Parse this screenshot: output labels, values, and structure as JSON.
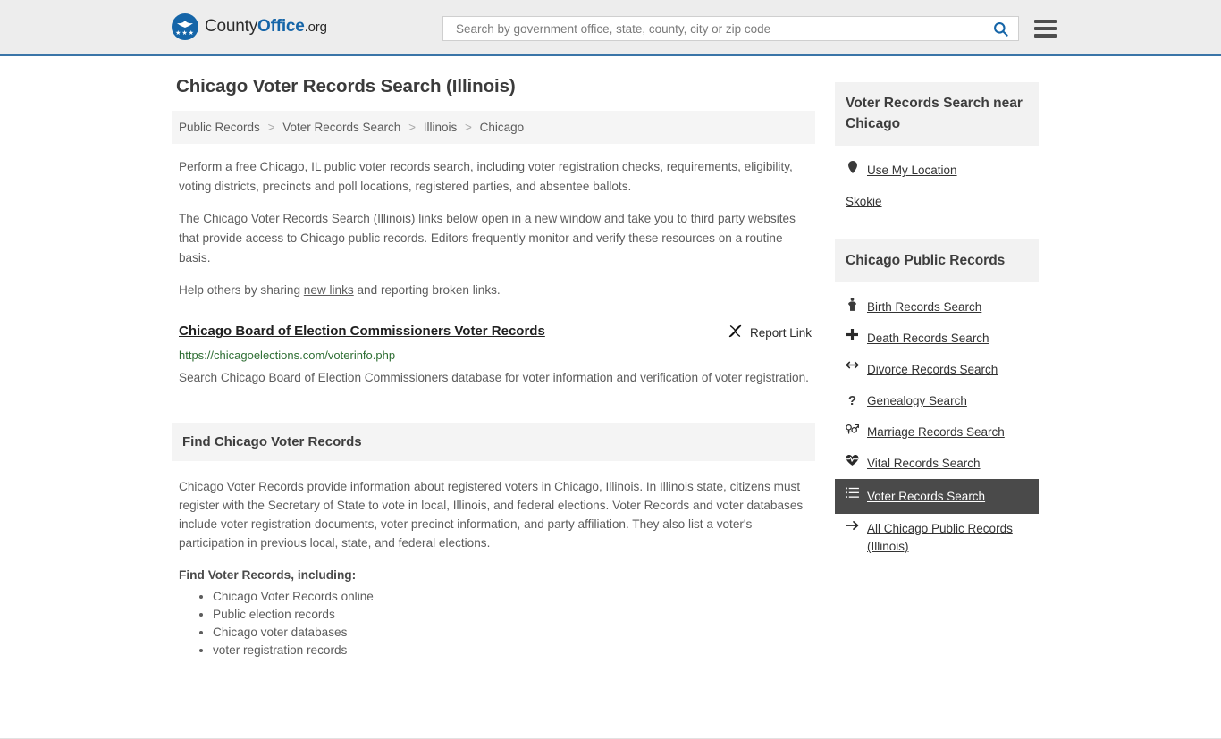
{
  "header": {
    "logo": {
      "part1": "County",
      "part2": "Office",
      "part3": ".org",
      "icon": "eagle-seal-icon",
      "stars": "★★★"
    },
    "search": {
      "placeholder": "Search by government office, state, county, city or zip code",
      "value": "",
      "search_icon": "search-icon",
      "menu_icon": "hamburger-menu-icon"
    },
    "accent_color": "#3a75a8"
  },
  "main": {
    "title": "Chicago Voter Records Search (Illinois)",
    "breadcrumb": [
      "Public Records",
      "Voter Records Search",
      "Illinois",
      "Chicago"
    ],
    "breadcrumb_separator": ">",
    "intro_1": "Perform a free Chicago, IL public voter records search, including voter registration checks, requirements, eligibility, voting districts, precincts and poll locations, registered parties, and absentee ballots.",
    "intro_2": "The Chicago Voter Records Search (Illinois) links below open in a new window and take you to third party websites that provide access to Chicago public records. Editors frequently monitor and verify these resources on a routine basis.",
    "help_prefix": "Help others by sharing ",
    "help_link": "new links",
    "help_suffix": " and reporting broken links.",
    "result": {
      "title": "Chicago Board of Election Commissioners Voter Records",
      "report_label": "Report Link",
      "report_icon": "broken-link-icon",
      "url": "https://chicagoelections.com/voterinfo.php",
      "url_color": "#2e6e33",
      "description": "Search Chicago Board of Election Commissioners database for voter information and verification of voter registration."
    },
    "section": {
      "heading": "Find Chicago Voter Records",
      "paragraph": "Chicago Voter Records provide information about registered voters in Chicago, Illinois. In Illinois state, citizens must register with the Secretary of State to vote in local, Illinois, and federal elections. Voter Records and voter databases include voter registration documents, voter precinct information, and party affiliation. They also list a voter's participation in previous local, state, and federal elections.",
      "list_heading": "Find Voter Records, including:",
      "list_items": [
        "Chicago Voter Records online",
        "Public election records",
        "Chicago voter databases",
        "voter registration records"
      ]
    }
  },
  "sidebar": {
    "near": {
      "heading": "Voter Records Search near Chicago",
      "items": [
        {
          "label": "Use My Location",
          "icon": "map-pin-icon",
          "has_icon": true
        },
        {
          "label": "Skokie",
          "icon": "",
          "has_icon": false
        }
      ]
    },
    "public_records": {
      "heading": "Chicago Public Records",
      "items": [
        {
          "label": "Birth Records Search",
          "icon": "person-icon",
          "glyph": "♈",
          "active": false
        },
        {
          "label": "Death Records Search",
          "icon": "cross-icon",
          "glyph": "✚",
          "active": false
        },
        {
          "label": "Divorce Records Search",
          "icon": "left-right-arrows-icon",
          "glyph": "↔",
          "active": false
        },
        {
          "label": "Genealogy Search",
          "icon": "question-mark-icon",
          "glyph": "?",
          "active": false
        },
        {
          "label": "Marriage Records Search",
          "icon": "venus-mars-icon",
          "glyph": "⚥",
          "active": false
        },
        {
          "label": "Vital Records Search",
          "icon": "heartbeat-icon",
          "glyph": "♥",
          "active": false
        },
        {
          "label": "Voter Records Search",
          "icon": "list-icon",
          "glyph": "☰",
          "active": true
        },
        {
          "label": "All Chicago Public Records (Illinois)",
          "icon": "arrow-right-icon",
          "glyph": "→",
          "active": false
        }
      ],
      "active_bg": "#4a4a4a"
    }
  }
}
